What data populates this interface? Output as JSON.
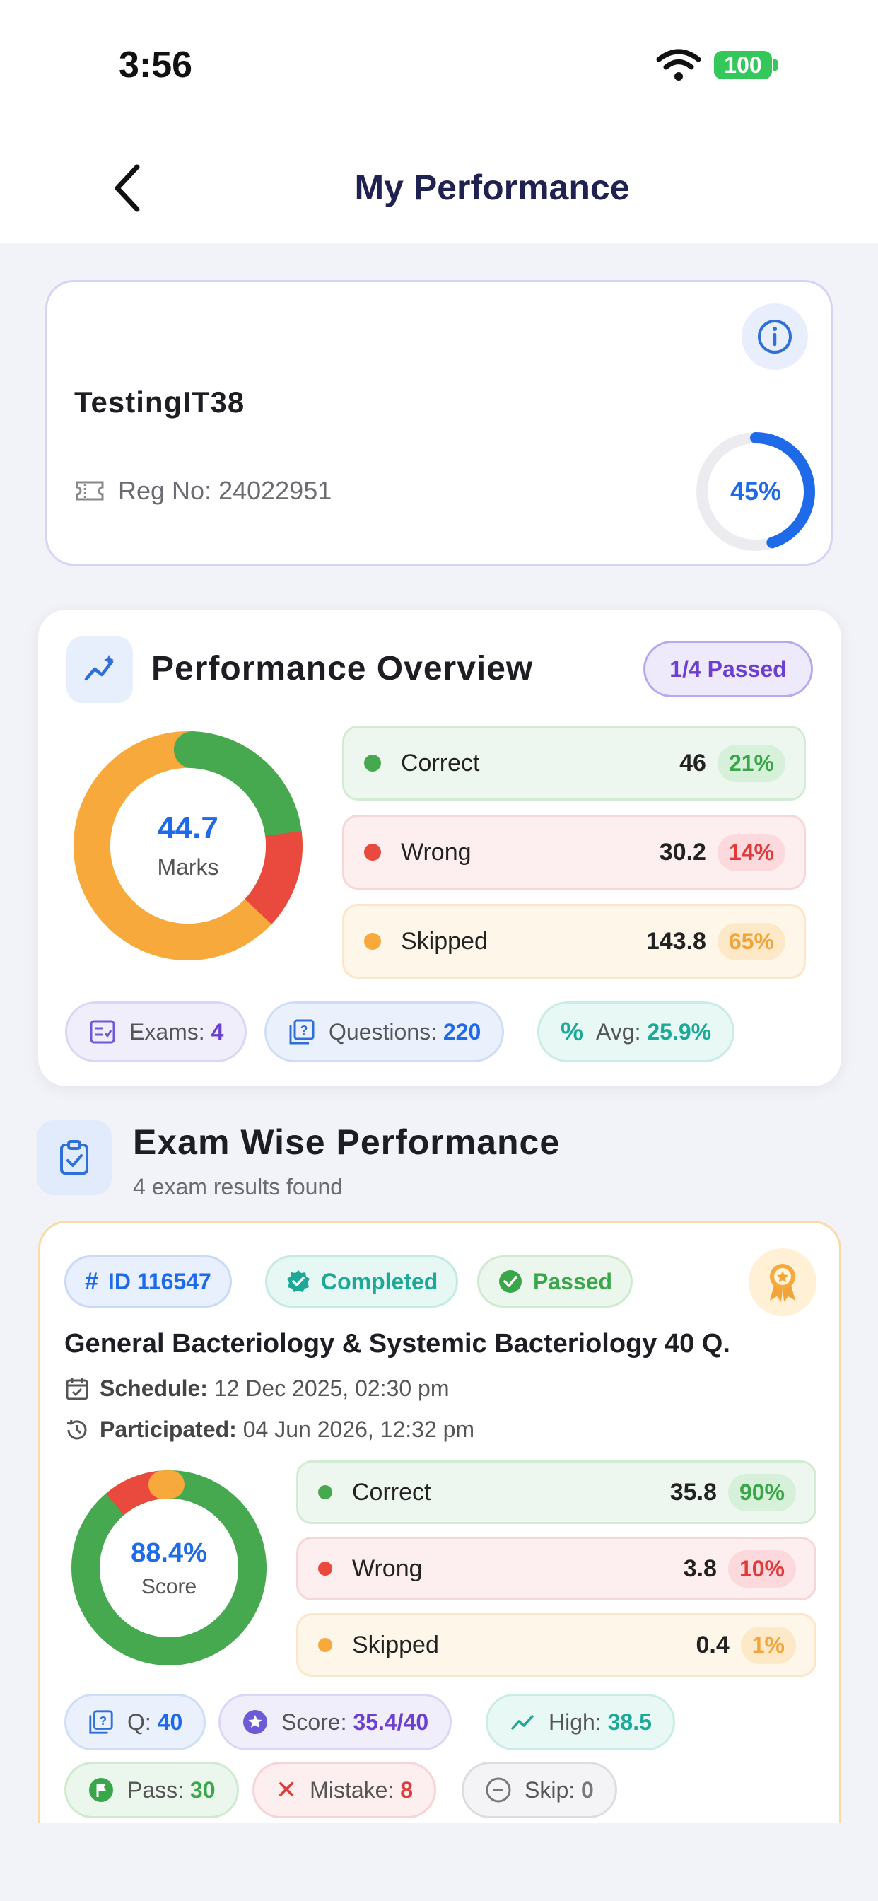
{
  "status_bar": {
    "time": "3:56",
    "battery": "100"
  },
  "header": {
    "title": "My Performance"
  },
  "profile": {
    "name": "TestingIT38",
    "reg_label": "Reg No: 24022951",
    "progress_label": "45%",
    "progress_value": 0.45
  },
  "overview": {
    "title": "Performance Overview",
    "passed_badge": "1/4 Passed",
    "marks_value": "44.7",
    "marks_label": "Marks",
    "correct": {
      "label": "Correct",
      "value": "46",
      "pct": "21%"
    },
    "wrong": {
      "label": "Wrong",
      "value": "30.2",
      "pct": "14%"
    },
    "skipped": {
      "label": "Skipped",
      "value": "143.8",
      "pct": "65%"
    },
    "chips": {
      "exams_label": "Exams:",
      "exams_value": "4",
      "questions_label": "Questions:",
      "questions_value": "220",
      "avg_label": "Avg:",
      "avg_value": "25.9%"
    },
    "colors": {
      "correct": "#46a84f",
      "wrong": "#ea4a3d",
      "skipped": "#f7a93b"
    }
  },
  "exam_wise": {
    "title": "Exam Wise Performance",
    "subtitle": "4 exam results found"
  },
  "exam": {
    "id": "ID 116547",
    "completed": "Completed",
    "passed": "Passed",
    "title": "General Bacteriology & Systemic Bacteriology 40 Q.",
    "schedule_label": "Schedule:",
    "schedule_value": "12 Dec 2025, 02:30 pm",
    "participated_label": "Participated:",
    "participated_value": "04 Jun 2026, 12:32 pm",
    "score_value": "88.4%",
    "score_label": "Score",
    "correct": {
      "label": "Correct",
      "value": "35.8",
      "pct": "90%"
    },
    "wrong": {
      "label": "Wrong",
      "value": "3.8",
      "pct": "10%"
    },
    "skipped": {
      "label": "Skipped",
      "value": "0.4",
      "pct": "1%"
    },
    "chips": {
      "q_label": "Q:",
      "q_value": "40",
      "score_label": "Score:",
      "score_value": "35.4/40",
      "high_label": "High:",
      "high_value": "38.5",
      "pass_label": "Pass:",
      "pass_value": "30",
      "mistake_label": "Mistake:",
      "mistake_value": "8",
      "skip_label": "Skip:",
      "skip_value": "0"
    }
  }
}
